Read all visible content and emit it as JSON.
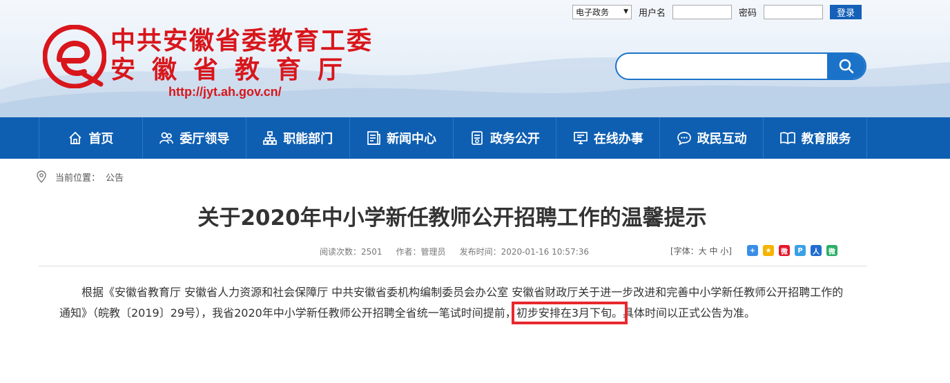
{
  "header": {
    "org_line1": "中共安徽省委教育工委",
    "org_line2": "安徽省教育厅",
    "url": "http://jyt.ah.gov.cn/",
    "logo_color": "#d8161b"
  },
  "login": {
    "system_select": "电子政务",
    "username_label": "用户名",
    "username_value": "",
    "password_label": "密码",
    "password_value": "",
    "login_button": "登录"
  },
  "search": {
    "placeholder": "",
    "icon": "search-icon"
  },
  "nav": {
    "items": [
      {
        "label": "首页",
        "icon": "home-icon"
      },
      {
        "label": "委厅领导",
        "icon": "leaders-icon"
      },
      {
        "label": "职能部门",
        "icon": "org-chart-icon"
      },
      {
        "label": "新闻中心",
        "icon": "news-icon"
      },
      {
        "label": "政务公开",
        "icon": "document-icon"
      },
      {
        "label": "在线办事",
        "icon": "monitor-icon"
      },
      {
        "label": "政民互动",
        "icon": "chat-icon"
      },
      {
        "label": "教育服务",
        "icon": "book-icon"
      }
    ],
    "background": "#0e5fb2"
  },
  "breadcrumb": {
    "label": "当前位置：",
    "current": "公告"
  },
  "article": {
    "title": "关于2020年中小学新任教师公开招聘工作的温馨提示",
    "views": "阅读次数：2501",
    "author": "作者：管理员",
    "published": "发布时间：2020-01-16 10:57:36",
    "font_size_control": "[字体：大 中 小]",
    "body_part1": "根据《安徽省教育厅 安徽省人力资源和社会保障厅 中共安徽省委机构编制委员会办公室 安徽省财政厅关于进一步改进和完善中小学新任教师公开招聘工作的通知》（皖教〔2019〕29号），我省2020年中小学新任教师公开招聘全省统一笔试时间提前，",
    "body_highlight": "初步安排在3月下旬。",
    "body_part2": "具体时间以正式公告为准。",
    "highlight_color": "#e8282e"
  },
  "share_icons": [
    "share-plus-icon",
    "qzone-icon",
    "weibo-icon",
    "tencent-weibo-icon",
    "renren-icon",
    "wechat-icon"
  ]
}
